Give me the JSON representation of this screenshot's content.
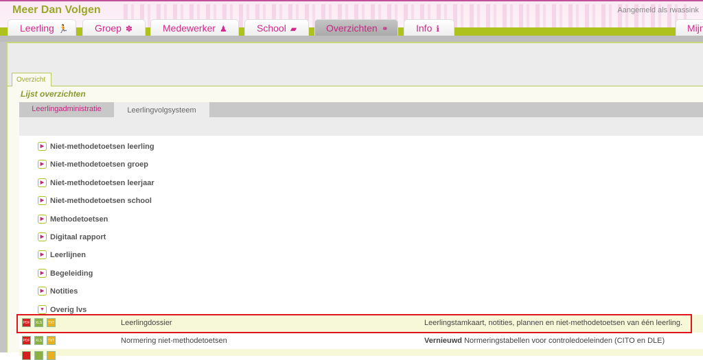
{
  "app": {
    "title": "Meer Dan Volgen",
    "login": "Aangemeld als rwassink"
  },
  "nav": [
    {
      "label": "Leerling",
      "icon": "running-child-icon",
      "glyph": "🏃"
    },
    {
      "label": "Groep",
      "icon": "group-icon",
      "glyph": "✽"
    },
    {
      "label": "Medewerker",
      "icon": "person-icon",
      "glyph": "♟"
    },
    {
      "label": "School",
      "icon": "school-icon",
      "glyph": "▰"
    },
    {
      "label": "Overzichten",
      "icon": "link-icon",
      "glyph": "⚭"
    },
    {
      "label": "Info",
      "icon": "info-icon",
      "glyph": "ℹ"
    },
    {
      "label": "Mijn"
    }
  ],
  "subtab": "Overzicht",
  "panel_title": "Lijst overzichten",
  "tabs": [
    "Leerlingadministratie",
    "Leerlingvolgsysteem"
  ],
  "categories": [
    "Niet-methodetoetsen leerling",
    "Niet-methodetoetsen groep",
    "Niet-methodetoetsen leerjaar",
    "Niet-methodetoetsen school",
    "Methodetoetsen",
    "Digitaal rapport",
    "Leerlijnen",
    "Begeleiding",
    "Notities",
    "Overig lvs"
  ],
  "formats": [
    "PDF",
    "XLS",
    "TXT"
  ],
  "reports": [
    {
      "name": "Leerlingdossier",
      "badge": "",
      "desc": "Leerlingstamkaart, notities, plannen en niet-methodetoetsen van één leerling."
    },
    {
      "name": "Normering niet-methodetoetsen",
      "badge": "Vernieuwd",
      "desc": "Normeringstabellen voor controledoeleinden (CITO en DLE)"
    }
  ],
  "colors": {
    "accent": "#aec21e",
    "brand": "#d0288c",
    "highlight": "#e0141e"
  }
}
